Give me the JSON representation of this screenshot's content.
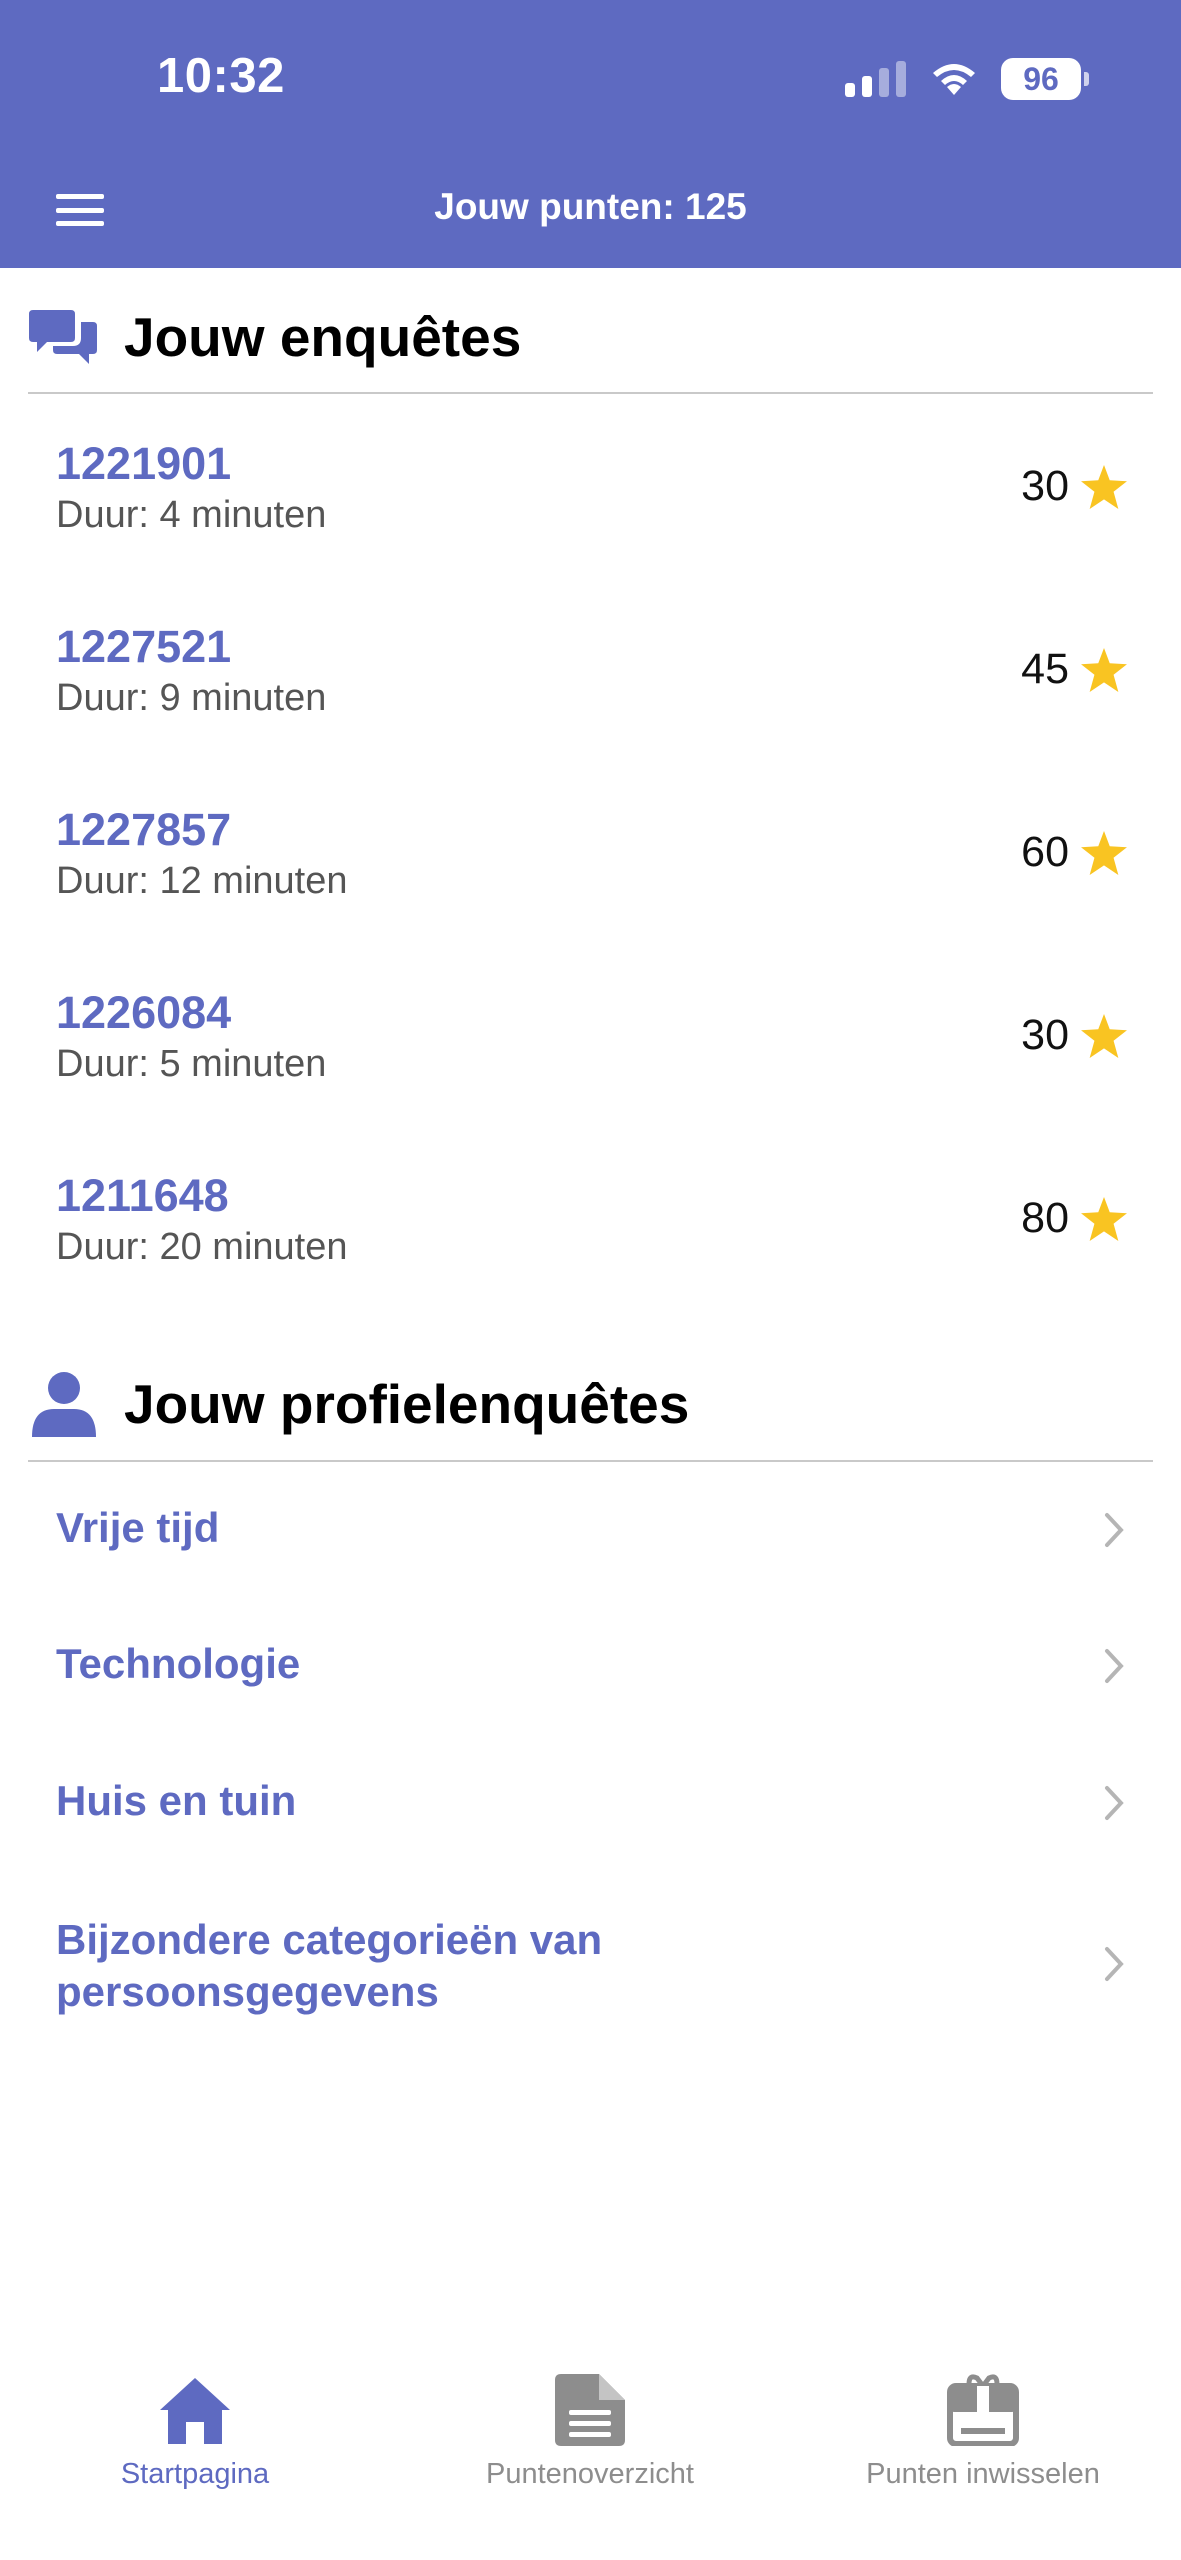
{
  "status_bar": {
    "time": "10:32",
    "battery": "96"
  },
  "header": {
    "title": "Jouw punten: 125"
  },
  "surveys_section": {
    "title": "Jouw enquêtes"
  },
  "surveys": [
    {
      "id": "1221901",
      "duration": "Duur: 4 minuten",
      "points": "30"
    },
    {
      "id": "1227521",
      "duration": "Duur: 9 minuten",
      "points": "45"
    },
    {
      "id": "1227857",
      "duration": "Duur: 12 minuten",
      "points": "60"
    },
    {
      "id": "1226084",
      "duration": "Duur: 5 minuten",
      "points": "30"
    },
    {
      "id": "1211648",
      "duration": "Duur: 20 minuten",
      "points": "80"
    }
  ],
  "profile_section": {
    "title": "Jouw profielenquêtes"
  },
  "profile_items": [
    {
      "label": "Vrije tijd"
    },
    {
      "label": "Technologie"
    },
    {
      "label": "Huis en tuin"
    },
    {
      "label": "Bijzondere categorieën van persoonsgegevens"
    }
  ],
  "tabs": [
    {
      "label": "Startpagina",
      "icon": "home-icon",
      "active": true
    },
    {
      "label": "Puntenoverzicht",
      "icon": "document-icon",
      "active": false
    },
    {
      "label": "Punten inwisselen",
      "icon": "gift-card-icon",
      "active": false
    }
  ],
  "colors": {
    "brand": "#5E6AC1",
    "star": "#F9C422",
    "chevron": "#B5B5B5",
    "inactive_tab": "#8D8D8D"
  }
}
